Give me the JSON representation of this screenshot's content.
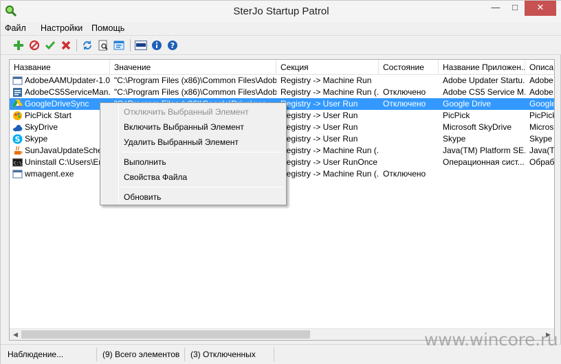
{
  "window": {
    "title": "SterJo Startup Patrol",
    "min_glyph": "—",
    "max_glyph": "□",
    "close_glyph": "✕",
    "close_color": "#c75050"
  },
  "menu": [
    "Файл",
    "Настройки",
    "Помощь"
  ],
  "toolbar_icons": [
    "add-icon",
    "disable-icon",
    "enable-icon",
    "delete-icon",
    "refresh-icon",
    "properties-icon",
    "run-icon",
    "donate-icon",
    "info-icon",
    "help-icon"
  ],
  "columns": [
    "Название",
    "Значение",
    "Секция",
    "Состояние",
    "Название Приложен...",
    "Описан"
  ],
  "rows": [
    {
      "name": "AdobeAAMUpdater-1.0",
      "value": "\"C:\\Program Files (x86)\\Common Files\\Adobe\\...",
      "section": "Registry -> Machine Run",
      "state": "",
      "app": "Adobe Updater Startu...",
      "desc": "Adobe",
      "icon": "window-icon"
    },
    {
      "name": "AdobeCS5ServiceMan...",
      "value": "\"C:\\Program Files (x86)\\Common Files\\Adobe\\...",
      "section": "Registry -> Machine Run (...",
      "state": "Отключено",
      "app": "Adobe CS5 Service M...",
      "desc": "Adobe",
      "icon": "adobe-service-icon"
    },
    {
      "name": "GoogleDriveSync",
      "value": "\"C:\\Program Files (x86)\\Google\\Drive\\goo...",
      "section": "Registry -> User Run",
      "state": "Отключено",
      "app": "Google Drive",
      "desc": "Google",
      "icon": "google-drive-icon",
      "selected": true
    },
    {
      "name": "PicPick Start",
      "value": "",
      "section": "Registry -> User Run",
      "state": "",
      "app": "PicPick",
      "desc": "PicPick",
      "icon": "picpick-icon"
    },
    {
      "name": "SkyDrive",
      "value": "",
      "section": "Registry -> User Run",
      "state": "",
      "app": "Microsoft SkyDrive",
      "desc": "Micros",
      "icon": "skydrive-icon"
    },
    {
      "name": "Skype",
      "value": "",
      "section": "Registry -> User Run",
      "state": "",
      "app": "Skype",
      "desc": "Skype",
      "icon": "skype-icon"
    },
    {
      "name": "SunJavaUpdateSched",
      "value": "",
      "section": "Registry -> Machine Run (...",
      "state": "",
      "app": "Java(TM) Platform SE...",
      "desc": "Java(T",
      "icon": "java-icon"
    },
    {
      "name": "Uninstall C:\\Users\\Евг",
      "value": "",
      "section": "Registry -> User RunOnce",
      "state": "",
      "app": "Операционная сист...",
      "desc": "Обрабо",
      "icon": "console-icon"
    },
    {
      "name": "wmagent.exe",
      "value": "",
      "section": "Registry -> Machine Run (...",
      "state": "Отключено",
      "app": "",
      "desc": "",
      "icon": "window-icon"
    }
  ],
  "context_menu": {
    "disable": "Отключить Выбранный Элемент",
    "enable": "Включить Выбранный Элемент",
    "delete": "Удалить Выбранный Элемент",
    "run": "Выполнить",
    "properties": "Свойства Файла",
    "refresh": "Обновить"
  },
  "status": {
    "state": "Наблюдение...",
    "total": "(9) Всего элементов",
    "disabled": "(3) Отключенных"
  },
  "watermark": "www.wincore.ru",
  "colors": {
    "selection": "#3399ff",
    "add": "#3aa83a",
    "delete": "#d03030",
    "info": "#1e5fb8"
  }
}
